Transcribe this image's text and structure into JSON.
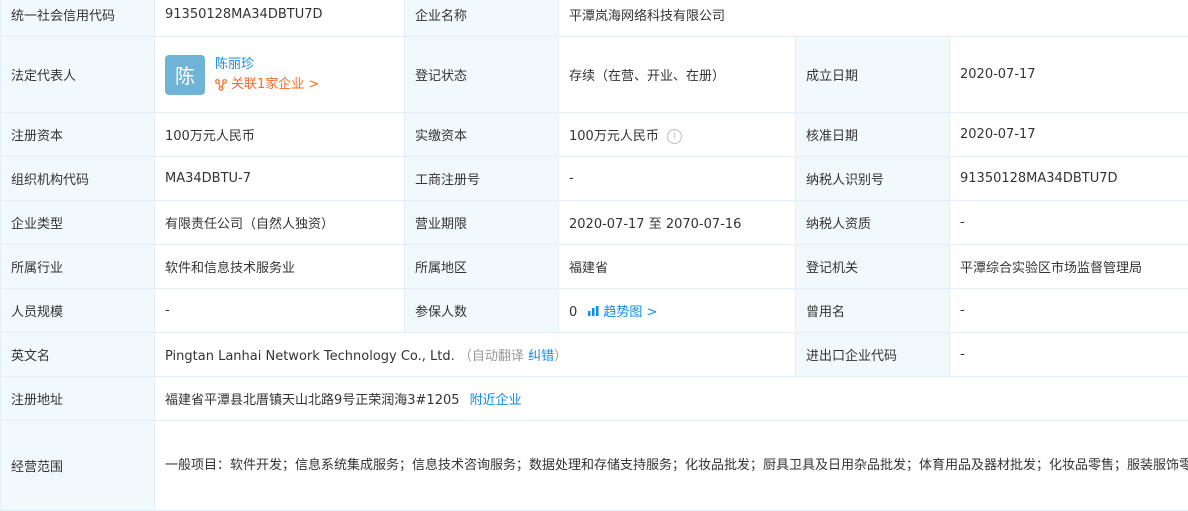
{
  "rows": {
    "uscc": {
      "label": "统一社会信用代码",
      "value": "91350128MA34DBTU7D"
    },
    "company_name": {
      "label": "企业名称",
      "value": "平潭岚海网络科技有限公司"
    },
    "legal_rep": {
      "label": "法定代表人",
      "avatar_char": "陈",
      "name": "陈丽珍",
      "related": "关联1家企业 >"
    },
    "reg_status": {
      "label": "登记状态",
      "value": "存续（在营、开业、在册）"
    },
    "found_date": {
      "label": "成立日期",
      "value": "2020-07-17"
    },
    "reg_capital": {
      "label": "注册资本",
      "value": "100万元人民币"
    },
    "paid_capital": {
      "label": "实缴资本",
      "value": "100万元人民币"
    },
    "approval_date": {
      "label": "核准日期",
      "value": "2020-07-17"
    },
    "org_code": {
      "label": "组织机构代码",
      "value": "MA34DBTU-7"
    },
    "biz_reg_no": {
      "label": "工商注册号",
      "value": "-"
    },
    "taxpayer_id": {
      "label": "纳税人识别号",
      "value": "91350128MA34DBTU7D"
    },
    "company_type": {
      "label": "企业类型",
      "value": "有限责任公司（自然人独资）"
    },
    "biz_term": {
      "label": "营业期限",
      "value": "2020-07-17 至 2070-07-16"
    },
    "taxpayer_qual": {
      "label": "纳税人资质",
      "value": "-"
    },
    "industry": {
      "label": "所属行业",
      "value": "软件和信息技术服务业"
    },
    "region": {
      "label": "所属地区",
      "value": "福建省"
    },
    "reg_authority": {
      "label": "登记机关",
      "value": "平潭综合实验区市场监督管理局"
    },
    "staff_size": {
      "label": "人员规模",
      "value": "-"
    },
    "insured": {
      "label": "参保人数",
      "value": "0",
      "trend": "趋势图 >"
    },
    "former_name": {
      "label": "曾用名",
      "value": "-"
    },
    "english_name": {
      "label": "英文名",
      "value": "Pingtan Lanhai Network Technology Co., Ltd.",
      "auto_translate": "（自动翻译",
      "correct": "纠错",
      "close_paren": "）"
    },
    "import_export": {
      "label": "进出口企业代码",
      "value": "-"
    },
    "reg_address": {
      "label": "注册地址",
      "value": "福建省平潭县北厝镇天山北路9号正荣润海3#1205",
      "nearby": "附近企业"
    },
    "biz_scope": {
      "label": "经营范围",
      "value": "一般项目：软件开发；信息系统集成服务；信息技术咨询服务；数据处理和存储支持服务；化妆品批发；厨具卫具及日用杂品批发；体育用品及器材批发；化妆品零售；服装服饰零售；鞋帽零售；箱包销售；钟表销售；眼镜销售（不含隐形眼镜）；家用电器销售；五金产品零售；灯具销售；卫生洁具销售；个人卫生用品销售；厨具卫具及日用杂品零售；建筑装饰材料销售（除依法须经批准的项目外，凭营业执照依法自主开展经营活动）"
    }
  },
  "colors": {
    "label_bg": "#f2f9fc",
    "border": "#e4eef6",
    "link": "#128bed",
    "orange": "#fd6a21",
    "avatar": "#6fb3d6"
  },
  "icons": {
    "related": "network-icon",
    "trend": "bar-chart-icon",
    "info": "info-circle-icon"
  }
}
